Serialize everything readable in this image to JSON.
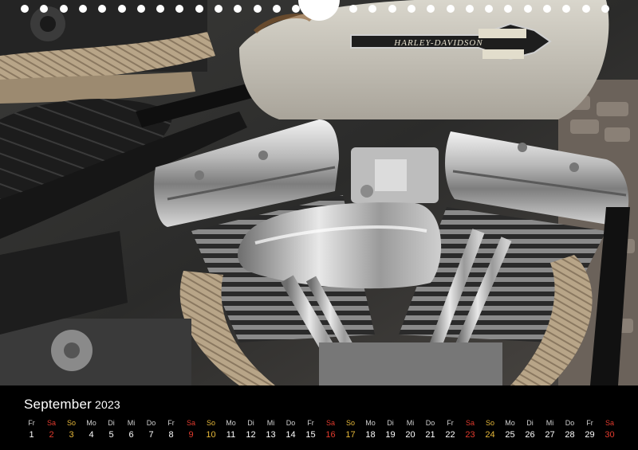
{
  "calendar": {
    "month": "September",
    "year": "2023",
    "days": [
      {
        "dn": "Fr",
        "d": "1",
        "t": "w"
      },
      {
        "dn": "Sa",
        "d": "2",
        "t": "sat"
      },
      {
        "dn": "So",
        "d": "3",
        "t": "sun"
      },
      {
        "dn": "Mo",
        "d": "4",
        "t": "w"
      },
      {
        "dn": "Di",
        "d": "5",
        "t": "w"
      },
      {
        "dn": "Mi",
        "d": "6",
        "t": "w"
      },
      {
        "dn": "Do",
        "d": "7",
        "t": "w"
      },
      {
        "dn": "Fr",
        "d": "8",
        "t": "w"
      },
      {
        "dn": "Sa",
        "d": "9",
        "t": "sat"
      },
      {
        "dn": "So",
        "d": "10",
        "t": "sun"
      },
      {
        "dn": "Mo",
        "d": "11",
        "t": "w"
      },
      {
        "dn": "Di",
        "d": "12",
        "t": "w"
      },
      {
        "dn": "Mi",
        "d": "13",
        "t": "w"
      },
      {
        "dn": "Do",
        "d": "14",
        "t": "w"
      },
      {
        "dn": "Fr",
        "d": "15",
        "t": "w"
      },
      {
        "dn": "Sa",
        "d": "16",
        "t": "sat"
      },
      {
        "dn": "So",
        "d": "17",
        "t": "sun"
      },
      {
        "dn": "Mo",
        "d": "18",
        "t": "w"
      },
      {
        "dn": "Di",
        "d": "19",
        "t": "w"
      },
      {
        "dn": "Mi",
        "d": "20",
        "t": "w"
      },
      {
        "dn": "Do",
        "d": "21",
        "t": "w"
      },
      {
        "dn": "Fr",
        "d": "22",
        "t": "w"
      },
      {
        "dn": "Sa",
        "d": "23",
        "t": "sat"
      },
      {
        "dn": "So",
        "d": "24",
        "t": "sun"
      },
      {
        "dn": "Mo",
        "d": "25",
        "t": "w"
      },
      {
        "dn": "Di",
        "d": "26",
        "t": "w"
      },
      {
        "dn": "Mi",
        "d": "27",
        "t": "w"
      },
      {
        "dn": "Do",
        "d": "28",
        "t": "w"
      },
      {
        "dn": "Fr",
        "d": "29",
        "t": "w"
      },
      {
        "dn": "Sa",
        "d": "30",
        "t": "sat"
      }
    ]
  },
  "photo": {
    "tank_logo": "HARLEY-DAVIDSON"
  },
  "colors": {
    "saturday": "#e23b2e",
    "sunday": "#e6b83a",
    "background": "#000000"
  }
}
